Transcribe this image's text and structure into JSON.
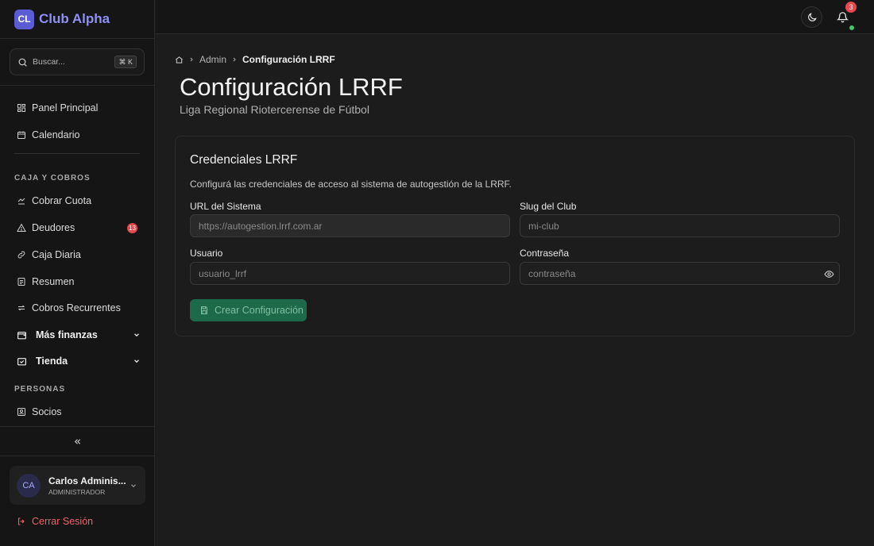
{
  "brand": {
    "logo_text": "CL",
    "name": "Club Alpha"
  },
  "search": {
    "placeholder": "Buscar...",
    "shortcut": "⌘ K"
  },
  "sidebar": {
    "items": [
      {
        "label": "Panel Principal",
        "icon": "dashboard-icon"
      },
      {
        "label": "Calendario",
        "icon": "calendar-icon"
      }
    ],
    "sections": [
      {
        "title": "CAJA Y COBROS",
        "items": [
          {
            "label": "Cobrar Cuota",
            "icon": "cash-icon"
          },
          {
            "label": "Deudores",
            "icon": "warning-icon",
            "badge": "13"
          },
          {
            "label": "Caja Diaria",
            "icon": "link-icon"
          },
          {
            "label": "Resumen",
            "icon": "document-icon"
          },
          {
            "label": "Cobros Recurrentes",
            "icon": "repeat-icon"
          }
        ],
        "groups": [
          {
            "label": "Más finanzas",
            "icon": "wallet-icon"
          },
          {
            "label": "Tienda",
            "icon": "store-icon"
          }
        ]
      },
      {
        "title": "PERSONAS",
        "items": [
          {
            "label": "Socios",
            "icon": "member-icon"
          }
        ]
      }
    ]
  },
  "user": {
    "initials": "CA",
    "name": "Carlos Adminis...",
    "role": "ADMINISTRADOR"
  },
  "logout": {
    "label": "Cerrar Sesión"
  },
  "topbar": {
    "notification_count": "3"
  },
  "breadcrumb": {
    "admin": "Admin",
    "current": "Configuración LRRF"
  },
  "page": {
    "title": "Configuración LRRF",
    "subtitle": "Liga Regional Riotercerense de Fútbol"
  },
  "card": {
    "title": "Credenciales LRRF",
    "description": "Configurá las credenciales de acceso al sistema de autogestión de la LRRF.",
    "fields": {
      "url": {
        "label": "URL del Sistema",
        "placeholder": "https://autogestion.lrrf.com.ar"
      },
      "slug": {
        "label": "Slug del Club",
        "placeholder": "mi-club"
      },
      "user": {
        "label": "Usuario",
        "placeholder": "usuario_lrrf"
      },
      "password": {
        "label": "Contraseña",
        "placeholder": "contraseña"
      }
    },
    "submit_label": "Crear Configuración"
  },
  "colors": {
    "accent": "#8f8ff5",
    "logo_bg": "#5b5bd6",
    "danger": "#e5484d",
    "success_button": "#1d6a4a",
    "online": "#46c46a"
  }
}
